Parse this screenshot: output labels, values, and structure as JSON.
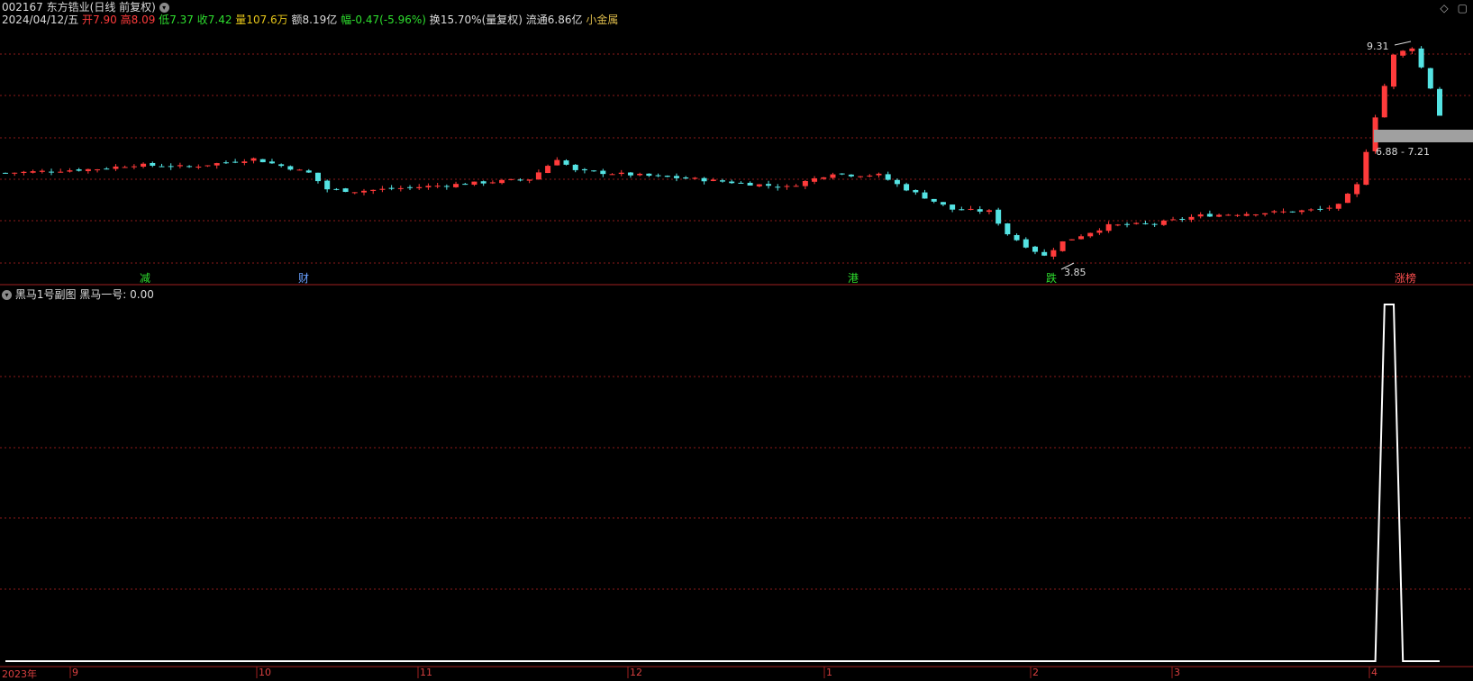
{
  "header": {
    "stock_code": "002167",
    "stock_name": "东方锆业",
    "period_info": "(日线 前复权)",
    "date": "2024/04/12/五",
    "open_label": "开",
    "open_value": "7.90",
    "high_label": "高",
    "high_value": "8.09",
    "low_label": "低",
    "low_value": "7.37",
    "close_label": "收",
    "close_value": "7.42",
    "volume_label": "量",
    "volume_value": "107.6万",
    "amount_label": "额",
    "amount_value": "8.19亿",
    "change_label": "幅",
    "change_value": "-0.47(-5.96%)",
    "turnover_label": "换",
    "turnover_value": "15.70%(量复权)",
    "float_label": "流通",
    "float_value": "6.86亿",
    "sector": "小金属"
  },
  "corner_icons": [
    "diamond-icon",
    "square-icon"
  ],
  "annotations": {
    "high_price": "9.31",
    "low_price": "3.85",
    "band_range": "6.88 - 7.21"
  },
  "event_labels": [
    {
      "text": "减",
      "color": "#2ede2e"
    },
    {
      "text": "财",
      "color": "#6aa0ff"
    },
    {
      "text": "港",
      "color": "#2ede2e"
    },
    {
      "text": "跌",
      "color": "#2ede2e"
    },
    {
      "text": "涨榜",
      "color": "#ff5050"
    }
  ],
  "subchart": {
    "title": "黑马1号副图",
    "indicator_label": "黑马一号:",
    "indicator_value": "0.00"
  },
  "x_axis": [
    "2023年",
    "9",
    "10",
    "11",
    "12",
    "1",
    "2",
    "3",
    "4"
  ],
  "colors": {
    "up": "#ff3b3b",
    "down": "#54e3e3",
    "grid": "#8b1a1a",
    "background": "#000000",
    "indicator_line": "#ffffff"
  },
  "chart_data": {
    "type": "candlestick",
    "ylim": [
      3.6,
      9.6
    ],
    "sessions": 157,
    "price_path": [
      [
        0,
        6.0
      ],
      [
        10,
        6.1
      ],
      [
        14,
        6.2
      ],
      [
        20,
        6.15
      ],
      [
        27,
        6.35
      ],
      [
        33,
        6.0
      ],
      [
        35,
        5.6
      ],
      [
        38,
        5.55
      ],
      [
        48,
        5.7
      ],
      [
        57,
        5.85
      ],
      [
        60,
        6.35
      ],
      [
        62,
        6.05
      ],
      [
        75,
        5.85
      ],
      [
        85,
        5.65
      ],
      [
        90,
        6.0
      ],
      [
        92,
        5.95
      ],
      [
        95,
        5.95
      ],
      [
        98,
        5.6
      ],
      [
        101,
        5.3
      ],
      [
        103,
        5.1
      ],
      [
        107,
        5.05
      ],
      [
        109,
        4.5
      ],
      [
        111,
        4.2
      ],
      [
        113,
        3.95
      ],
      [
        115,
        4.3
      ],
      [
        120,
        4.7
      ],
      [
        125,
        4.75
      ],
      [
        130,
        4.95
      ],
      [
        135,
        5.0
      ],
      [
        140,
        5.05
      ],
      [
        143,
        5.1
      ],
      [
        145,
        5.2
      ],
      [
        147,
        5.7
      ],
      [
        149,
        7.4
      ],
      [
        151,
        8.9
      ],
      [
        153,
        9.1
      ],
      [
        155,
        8.1
      ],
      [
        156,
        7.42
      ]
    ],
    "indicator_path": [
      [
        0,
        0
      ],
      [
        149,
        0
      ],
      [
        150,
        1
      ],
      [
        151,
        1
      ],
      [
        152,
        0
      ],
      [
        156,
        0
      ]
    ],
    "indicator_ylim": [
      0,
      1
    ]
  }
}
